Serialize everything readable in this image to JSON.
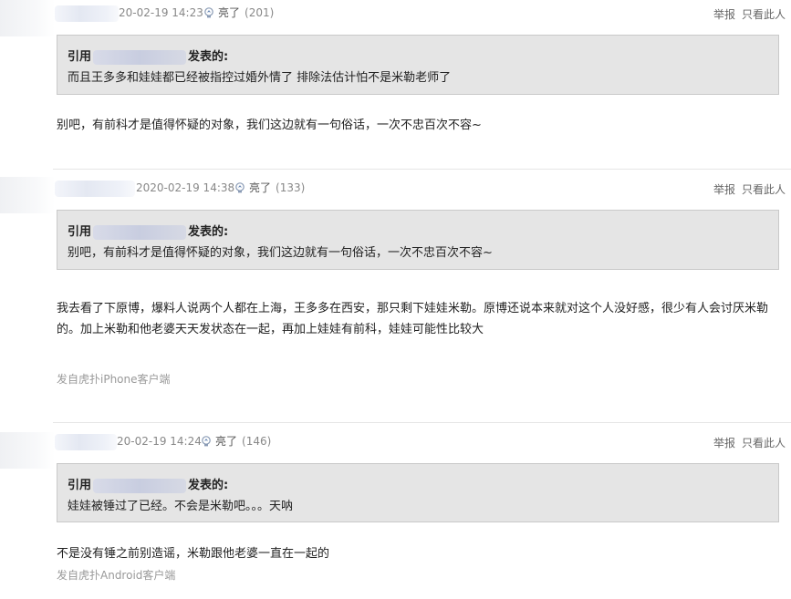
{
  "posts": [
    {
      "time": "20-02-19 14:23",
      "light_label": "亮了",
      "light_count": "(201)",
      "report": "举报",
      "only_this": "只看此人",
      "quote": {
        "prefix": "引用",
        "suffix": "发表的:",
        "text": "而且王多多和娃娃都已经被指控过婚外情了 排除法估计怕不是米勒老师了"
      },
      "body": "别吧，有前科才是值得怀疑的对象，我们这边就有一句俗话，一次不忠百次不容~"
    },
    {
      "time": "2020-02-19 14:38",
      "light_label": "亮了",
      "light_count": "(133)",
      "report": "举报",
      "only_this": "只看此人",
      "quote": {
        "prefix": "引用",
        "suffix": "发表的:",
        "text": "别吧，有前科才是值得怀疑的对象，我们这边就有一句俗话，一次不忠百次不容~"
      },
      "body": "我去看了下原博，爆料人说两个人都在上海，王多多在西安，那只剩下娃娃米勒。原博还说本来就对这个人没好感，很少有人会讨厌米勒的。加上米勒和他老婆天天发状态在一起，再加上娃娃有前科，娃娃可能性比较大",
      "source": "发自虎扑iPhone客户端"
    },
    {
      "time": "20-02-19 14:24",
      "light_label": "亮了",
      "light_count": "(146)",
      "report": "举报",
      "only_this": "只看此人",
      "quote": {
        "prefix": "引用",
        "suffix": "发表的:",
        "text": "娃娃被锤过了已经。不会是米勒吧。。。天呐"
      },
      "body": "不是没有锤之前别造谣，米勒跟他老婆一直在一起的",
      "source": "发自虎扑Android客户端"
    }
  ],
  "colors": {
    "quote_bg": "#e5e5e5",
    "meta": "#888888",
    "source": "#999999"
  },
  "icons": {
    "light": "lightbulb-icon"
  }
}
